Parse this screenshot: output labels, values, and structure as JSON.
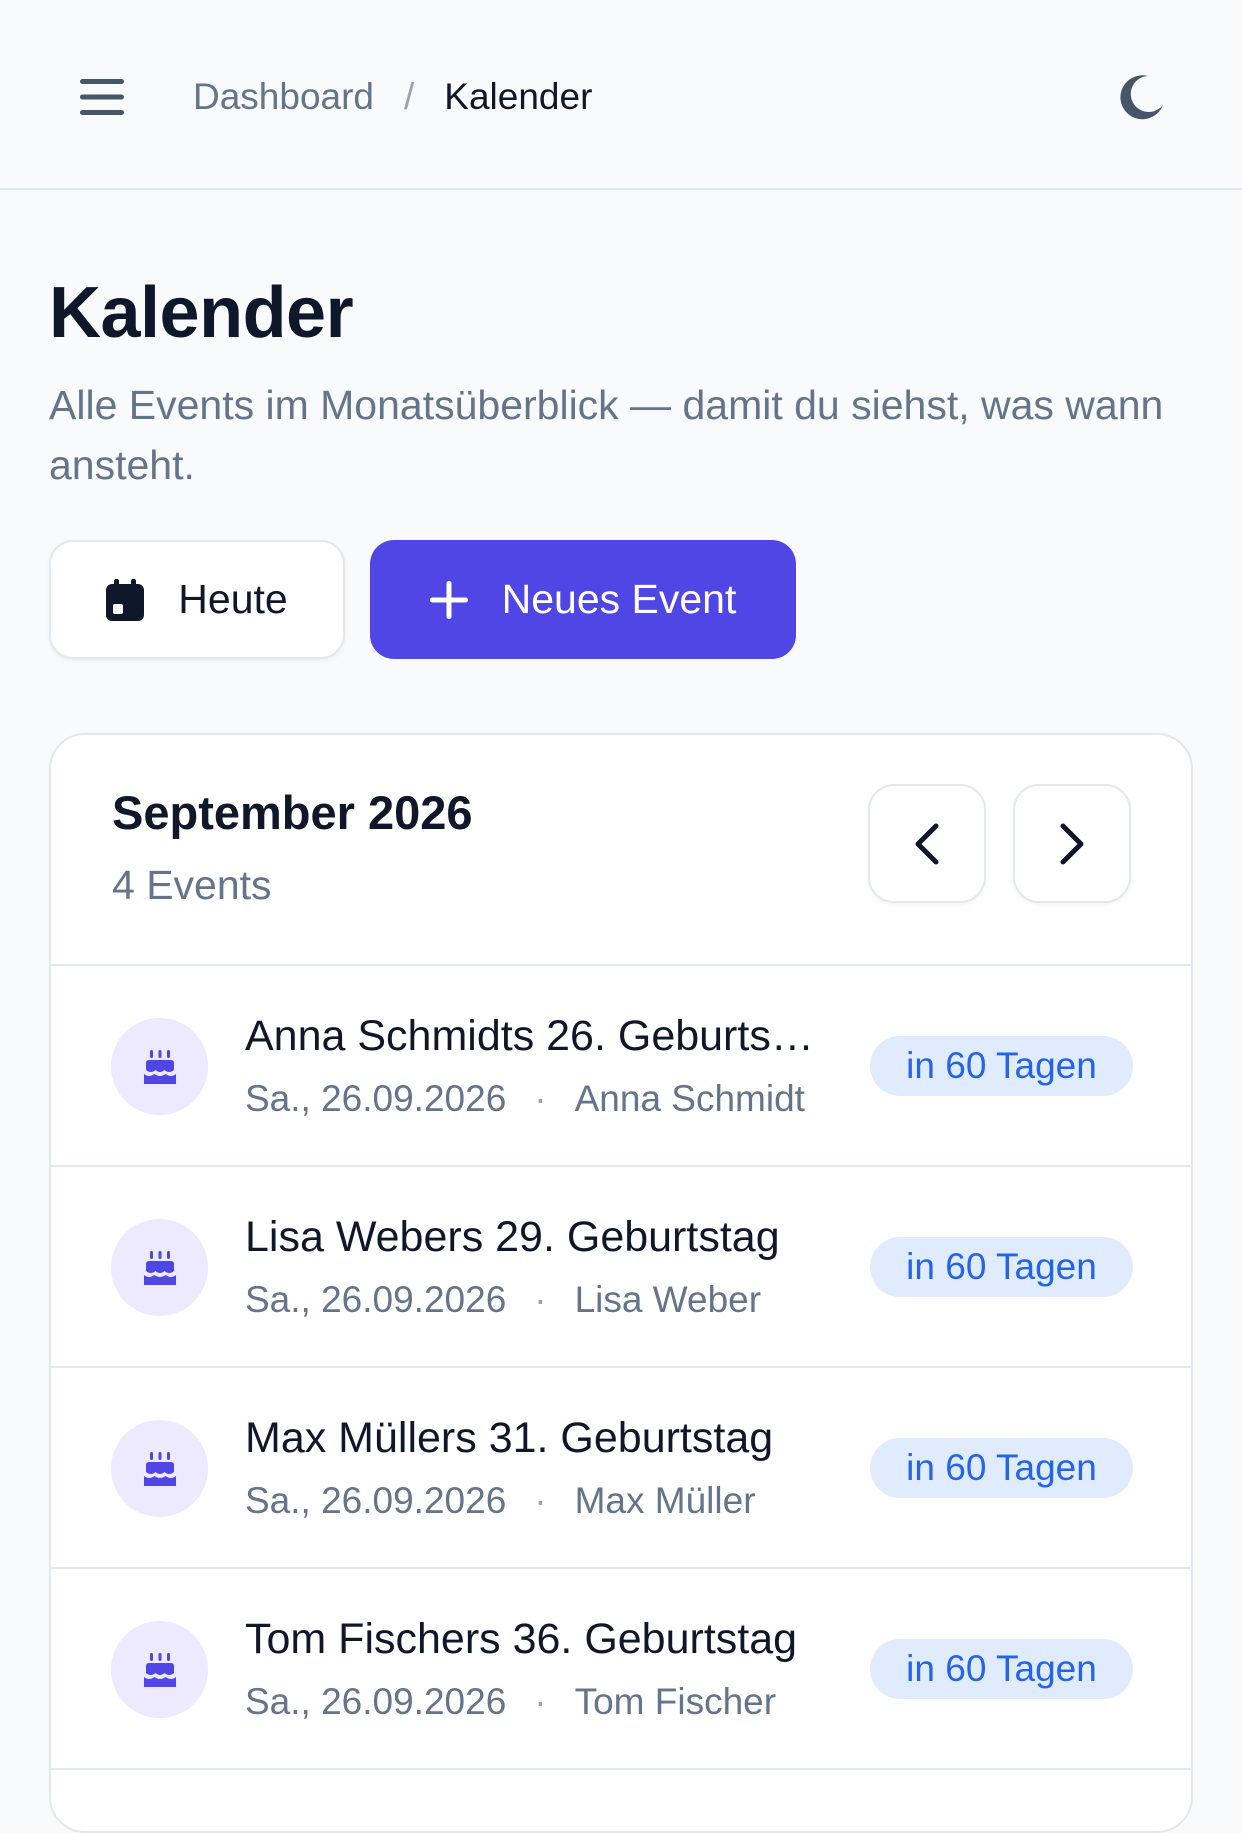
{
  "header": {
    "breadcrumb": {
      "parent": "Dashboard",
      "separator": "/",
      "current": "Kalender"
    }
  },
  "page": {
    "title": "Kalender",
    "subtitle": "Alle Events im Monatsüberblick — damit du siehst, was wann ansteht."
  },
  "actions": {
    "today_label": "Heute",
    "new_event_label": "Neues Event"
  },
  "calendar": {
    "month_label": "September 2026",
    "event_count": "4 Events",
    "events": [
      {
        "title": "Anna Schmidts 26. Geburts…",
        "date": "Sa., 26.09.2026",
        "person": "Anna Schmidt",
        "badge": "in 60 Tagen",
        "icon": "cake-icon"
      },
      {
        "title": "Lisa Webers 29. Geburtstag",
        "date": "Sa., 26.09.2026",
        "person": "Lisa Weber",
        "badge": "in 60 Tagen",
        "icon": "cake-icon"
      },
      {
        "title": "Max Müllers 31. Geburtstag",
        "date": "Sa., 26.09.2026",
        "person": "Max Müller",
        "badge": "in 60 Tagen",
        "icon": "cake-icon"
      },
      {
        "title": "Tom Fischers 36. Geburtstag",
        "date": "Sa., 26.09.2026",
        "person": "Tom Fischer",
        "badge": "in 60 Tagen",
        "icon": "cake-icon"
      }
    ]
  },
  "colors": {
    "accent": "#4f46e5",
    "badge_bg": "#e0ecfd",
    "badge_text": "#2563eb",
    "avatar_bg": "#ede9fe"
  },
  "icons": {
    "menu": "menu-icon",
    "theme": "moon-icon",
    "today": "calendar-icon",
    "new_event": "plus-icon",
    "prev": "chevron-left-icon",
    "next": "chevron-right-icon"
  }
}
